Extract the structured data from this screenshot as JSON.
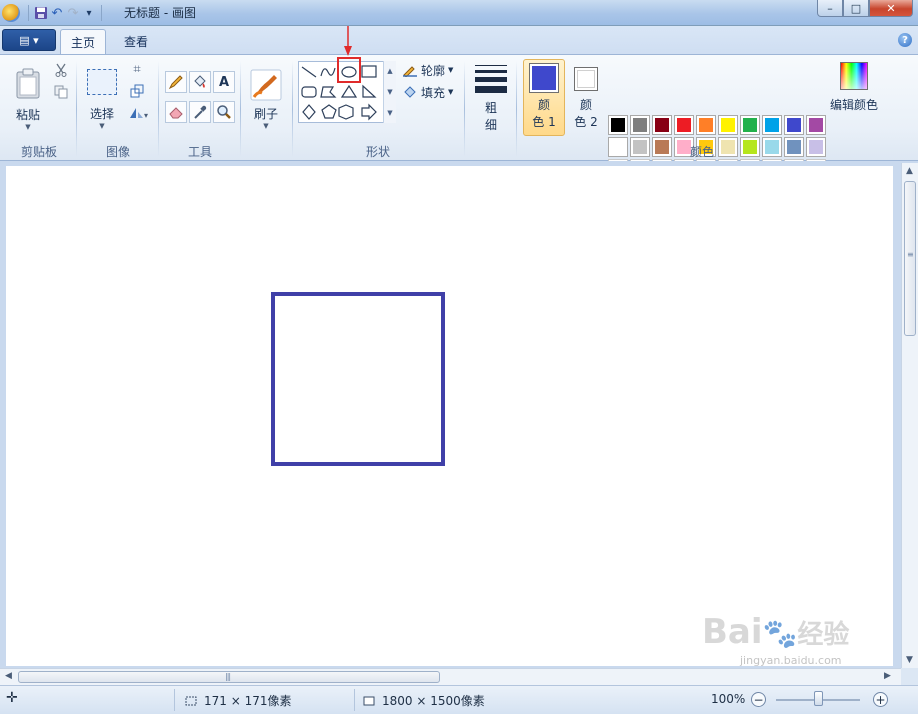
{
  "window": {
    "title": "无标题 - 画图",
    "minimize": "–",
    "maximize": "□",
    "close": "✕"
  },
  "quick_access": {
    "save_icon": "floppy-icon",
    "undo": "↶",
    "redo": "↷",
    "customize": "▾"
  },
  "menu_button": "▤ ▾",
  "tabs": [
    {
      "label": "主页",
      "active": true
    },
    {
      "label": "查看",
      "active": false
    }
  ],
  "help": "?",
  "ribbon": {
    "clipboard": {
      "paste_label": "粘贴",
      "group_label": "剪贴板"
    },
    "image": {
      "select_label": "选择",
      "group_label": "图像"
    },
    "tools": {
      "group_label": "工具",
      "text_glyph": "A"
    },
    "brushes": {
      "label": "刷子"
    },
    "shapes": {
      "group_label": "形状",
      "outline_label": "轮廓",
      "fill_label": "填充"
    },
    "size": {
      "label_top": "粗",
      "label_bottom": "细"
    },
    "colors": {
      "group_label": "颜色",
      "color1_top": "颜",
      "color1_bottom": "色 1",
      "color2_top": "颜",
      "color2_bottom": "色 2",
      "color1_value": "#3f48cc",
      "color2_value": "#ffffff",
      "edit_label": "编辑颜色",
      "palette_row1": [
        "#000000",
        "#7f7f7f",
        "#880015",
        "#ed1c24",
        "#ff7f27",
        "#fff200",
        "#22b14c",
        "#00a2e8",
        "#3f48cc",
        "#a349a4"
      ],
      "palette_row2": [
        "#ffffff",
        "#c3c3c3",
        "#b97a57",
        "#ffaec9",
        "#ffc90e",
        "#efe4b0",
        "#b5e61d",
        "#99d9ea",
        "#7092be",
        "#c8bfe7"
      ],
      "palette_row3": [
        "#f2f2f2",
        "#f2f2f2",
        "#f2f2f2",
        "#f2f2f2",
        "#f2f2f2",
        "#f2f2f2",
        "#f2f2f2",
        "#f2f2f2",
        "#f2f2f2",
        "#f2f2f2"
      ]
    }
  },
  "canvas": {
    "square_stroke": "#4040a8"
  },
  "status": {
    "move_icon": "✛",
    "selection_size": "171 × 171像素",
    "canvas_size": "1800 × 1500像素",
    "zoom": "100%",
    "zoom_out": "−",
    "zoom_in": "+"
  },
  "watermark": {
    "text": "Bai",
    "text2": "经验",
    "sub": "jingyan.baidu.com"
  }
}
